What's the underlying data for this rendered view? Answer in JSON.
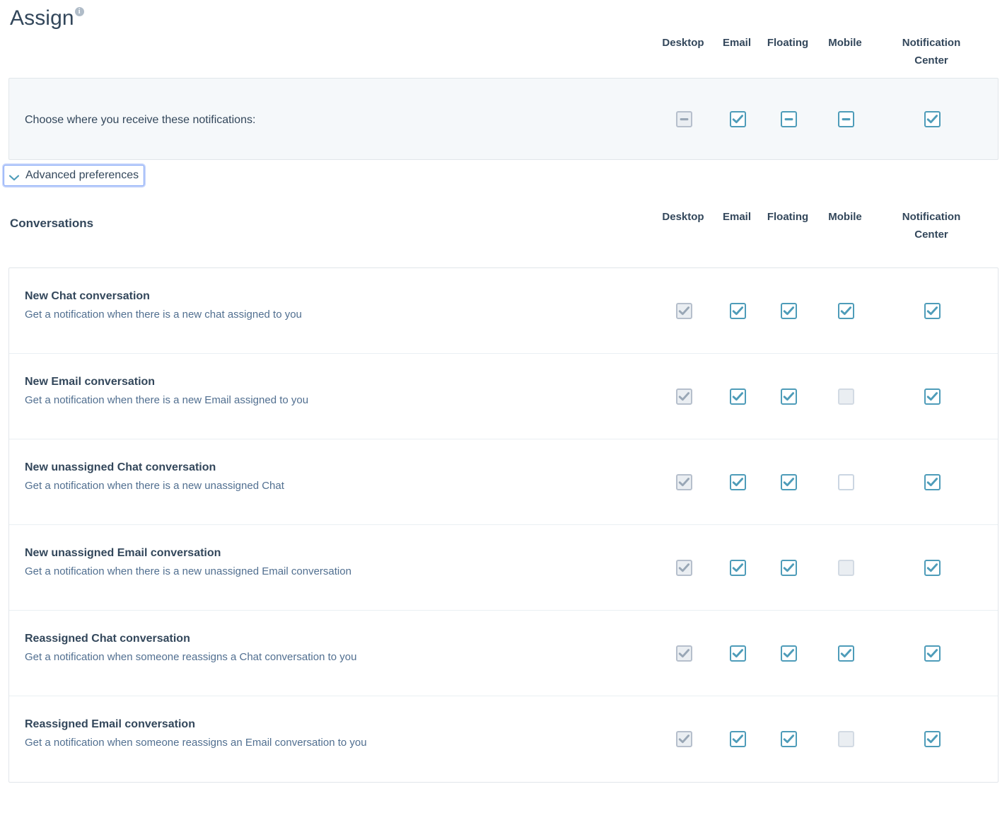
{
  "page": {
    "title": "Assign",
    "info_icon": "info-icon"
  },
  "columns": [
    "Desktop",
    "Email",
    "Floating",
    "Mobile",
    "Notification Center"
  ],
  "summary": {
    "label": "Choose where you receive these notifications:",
    "states": [
      "indeterminate-disabled",
      "checked",
      "indeterminate",
      "indeterminate",
      "checked"
    ]
  },
  "advanced": {
    "label": "Advanced preferences",
    "icon": "chevron-down-icon",
    "expanded": true,
    "focused": true
  },
  "section": {
    "title": "Conversations",
    "columns": [
      "Desktop",
      "Email",
      "Floating",
      "Mobile",
      "Notification Center"
    ],
    "rows": [
      {
        "title": "New Chat conversation",
        "description": "Get a notification when there is a new chat assigned to you",
        "states": [
          "checked-disabled",
          "checked",
          "checked",
          "checked",
          "checked"
        ]
      },
      {
        "title": "New Email conversation",
        "description": "Get a notification when there is a new Email assigned to you",
        "states": [
          "checked-disabled",
          "checked",
          "checked",
          "unchecked-disabled",
          "checked"
        ]
      },
      {
        "title": "New unassigned Chat conversation",
        "description": "Get a notification when there is a new unassigned Chat",
        "states": [
          "checked-disabled",
          "checked",
          "checked",
          "unchecked-enabled",
          "checked"
        ]
      },
      {
        "title": "New unassigned Email conversation",
        "description": "Get a notification when there is a new unassigned Email conversation",
        "states": [
          "checked-disabled",
          "checked",
          "checked",
          "unchecked-disabled",
          "checked"
        ]
      },
      {
        "title": "Reassigned Chat conversation",
        "description": "Get a notification when someone reassigns a Chat conversation to you",
        "states": [
          "checked-disabled",
          "checked",
          "checked",
          "checked",
          "checked"
        ]
      },
      {
        "title": "Reassigned Email conversation",
        "description": "Get a notification when someone reassigns an Email conversation to you",
        "states": [
          "checked-disabled",
          "checked",
          "checked",
          "unchecked-disabled",
          "checked"
        ]
      }
    ]
  },
  "colors": {
    "accent_teal": "#4e9cb9",
    "text_dark": "#33475b",
    "text_muted": "#516f90",
    "panel_bg": "#f5f8fa",
    "border": "#e1e6ea",
    "disabled_border": "#b6bfcc",
    "disabled_fill": "#eaeef2",
    "focus_ring": "#7fa3f7"
  }
}
